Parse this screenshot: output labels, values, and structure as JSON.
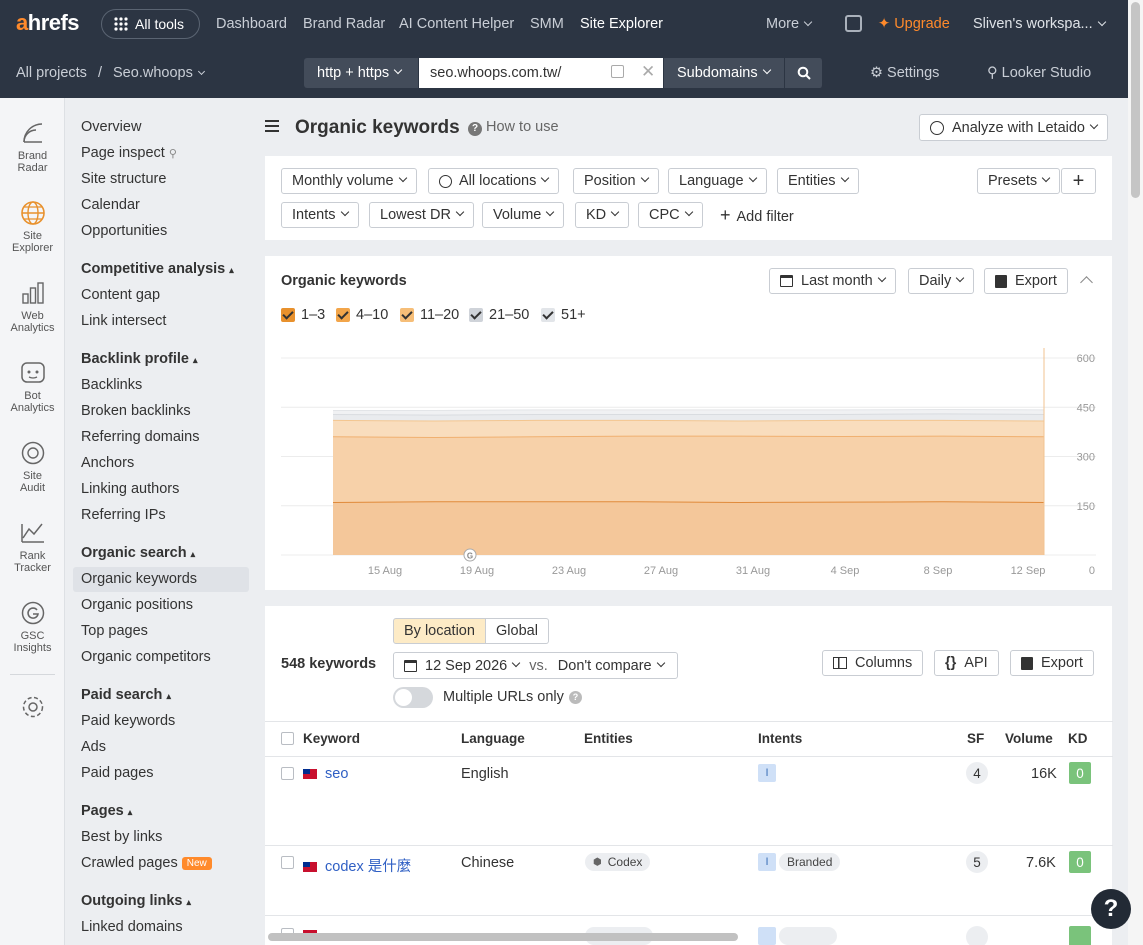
{
  "topbar": {
    "logo_a": "a",
    "logo_rest": "hrefs",
    "all_tools": "All tools",
    "nav": [
      "Dashboard",
      "Brand Radar",
      "AI Content Helper",
      "SMM",
      "Site Explorer"
    ],
    "more": "More",
    "upgrade": "Upgrade",
    "workspace": "Sliven's workspa..."
  },
  "breadcrumb": {
    "root": "All projects",
    "sep": "/",
    "project": "Seo.whoops"
  },
  "urlbar": {
    "protocol": "http + https",
    "url": "seo.whoops.com.tw/",
    "mode": "Subdomains"
  },
  "settings": "Settings",
  "looker": "Looker Studio",
  "rail": [
    {
      "l1": "Brand",
      "l2": "Radar"
    },
    {
      "l1": "Site",
      "l2": "Explorer"
    },
    {
      "l1": "Web",
      "l2": "Analytics"
    },
    {
      "l1": "Bot",
      "l2": "Analytics"
    },
    {
      "l1": "Site",
      "l2": "Audit"
    },
    {
      "l1": "Rank",
      "l2": "Tracker"
    },
    {
      "l1": "GSC",
      "l2": "Insights"
    }
  ],
  "sidenav": {
    "top": [
      "Overview",
      "Page inspect",
      "Site structure",
      "Calendar",
      "Opportunities"
    ],
    "competitive": {
      "title": "Competitive analysis",
      "items": [
        "Content gap",
        "Link intersect"
      ]
    },
    "backlink": {
      "title": "Backlink profile",
      "items": [
        "Backlinks",
        "Broken backlinks",
        "Referring domains",
        "Anchors",
        "Linking authors",
        "Referring IPs"
      ]
    },
    "organic": {
      "title": "Organic search",
      "items": [
        "Organic keywords",
        "Organic positions",
        "Top pages",
        "Organic competitors"
      ]
    },
    "paid": {
      "title": "Paid search",
      "items": [
        "Paid keywords",
        "Ads",
        "Paid pages"
      ]
    },
    "pages": {
      "title": "Pages",
      "items": [
        "Best by links",
        "Crawled pages"
      ],
      "new_badge": "New"
    },
    "outgoing": {
      "title": "Outgoing links",
      "items": [
        "Linked domains"
      ]
    }
  },
  "page": {
    "title": "Organic keywords",
    "how_to": "How to use",
    "analyze": "Analyze with Letaido"
  },
  "filters": {
    "row1": [
      "Monthly volume",
      "All locations",
      "Position",
      "Language",
      "Entities"
    ],
    "row2": [
      "Intents",
      "Lowest DR",
      "Volume",
      "KD",
      "CPC"
    ],
    "add_filter": "Add filter",
    "presets": "Presets"
  },
  "chart_panel": {
    "title": "Organic keywords",
    "period": "Last month",
    "interval": "Daily",
    "export": "Export",
    "legend": [
      {
        "label": "1–3",
        "color": "#e8912d",
        "checked": true
      },
      {
        "label": "4–10",
        "color": "#f2a54a",
        "checked": true
      },
      {
        "label": "11–20",
        "color": "#f6be78",
        "checked": true
      },
      {
        "label": "21–50",
        "color": "#cfd3d9",
        "checked": true
      },
      {
        "label": "51+",
        "color": "#e2e5e9",
        "checked": true
      }
    ]
  },
  "chart_data": {
    "type": "area",
    "x": [
      "15 Aug",
      "19 Aug",
      "23 Aug",
      "27 Aug",
      "31 Aug",
      "4 Sep",
      "8 Sep",
      "12 Sep"
    ],
    "y_ticks": [
      600,
      450,
      300,
      150,
      0
    ],
    "ylim": [
      0,
      600
    ],
    "series": [
      {
        "name": "1–3",
        "values": [
          160,
          162,
          162,
          162,
          160,
          161,
          162,
          160
        ]
      },
      {
        "name": "4–10",
        "values": [
          360,
          358,
          360,
          362,
          362,
          361,
          362,
          360
        ]
      },
      {
        "name": "11–20",
        "values": [
          410,
          408,
          410,
          410,
          408,
          410,
          410,
          408
        ]
      },
      {
        "name": "21–50",
        "values": [
          428,
          426,
          428,
          428,
          428,
          428,
          430,
          428
        ]
      },
      {
        "name": "51+",
        "values": [
          440,
          440,
          442,
          442,
          442,
          442,
          443,
          442
        ]
      }
    ],
    "grid": true,
    "legend": "top-left"
  },
  "table_panel": {
    "tab_location": "By location",
    "tab_global": "Global",
    "count": "548 keywords",
    "date": "12 Sep 2026",
    "vs": "vs.",
    "compare": "Don't compare",
    "columns": "Columns",
    "api": "API",
    "export": "Export",
    "multiple_urls": "Multiple URLs only",
    "headers": [
      "Keyword",
      "Language",
      "Entities",
      "Intents",
      "SF",
      "Volume",
      "KD"
    ],
    "rows": [
      {
        "keyword": "seo",
        "language": "English",
        "entity": "",
        "intent": "I",
        "branded": "",
        "sf": "4",
        "volume": "16K",
        "kd": "0"
      },
      {
        "keyword": "codex 是什麼",
        "language": "Chinese",
        "entity": "Codex",
        "intent": "I",
        "branded": "Branded",
        "sf": "5",
        "volume": "7.6K",
        "kd": "0"
      }
    ]
  },
  "help": "?"
}
